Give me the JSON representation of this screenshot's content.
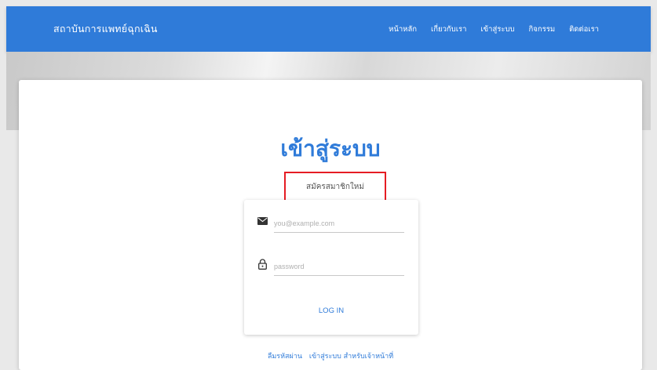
{
  "navbar": {
    "brand": "สถาบันการแพทย์ฉุกเฉิน",
    "links": [
      "หน้าหลัก",
      "เกี่ยวกับเรา",
      "เข้าสู่ระบบ",
      "กิจกรรม",
      "ติดต่อเรา"
    ]
  },
  "login": {
    "title": "เข้าสู่ระบบ",
    "register_label": "สมัครสมาชิกใหม่",
    "email_placeholder": "you@example.com",
    "password_placeholder": "password",
    "login_label": "LOG IN",
    "forgot_label": "ลืมรหัสผ่าน",
    "staff_login_label": "เข้าสู่ระบบ สำหรับเจ้าหน้าที่"
  },
  "colors": {
    "primary": "#2f7bd9",
    "highlight": "#e51c23"
  },
  "icons": {
    "email": "envelope-icon",
    "password": "lock-icon"
  }
}
